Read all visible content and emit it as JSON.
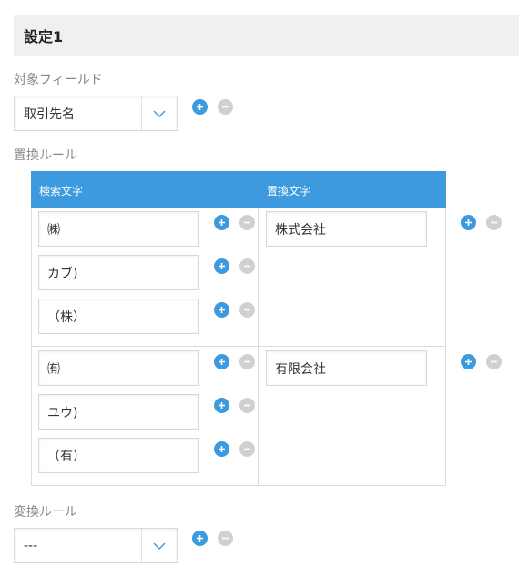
{
  "section": {
    "title": "設定1"
  },
  "target_field": {
    "label": "対象フィールド",
    "selected": "取引先名"
  },
  "replace_rules": {
    "label": "置換ルール",
    "header_search": "検索文字",
    "header_replace": "置換文字",
    "groups": [
      {
        "search": [
          "㈱",
          "カブ)",
          "（株）"
        ],
        "replace": "株式会社"
      },
      {
        "search": [
          "㈲",
          "ユウ)",
          "（有）"
        ],
        "replace": "有限会社"
      }
    ]
  },
  "convert_rule": {
    "label": "変換ルール",
    "selected": "---"
  },
  "colors": {
    "accent": "#3d9ade",
    "remove": "#d0d0d0",
    "header_bg": "#f0f0f0"
  }
}
